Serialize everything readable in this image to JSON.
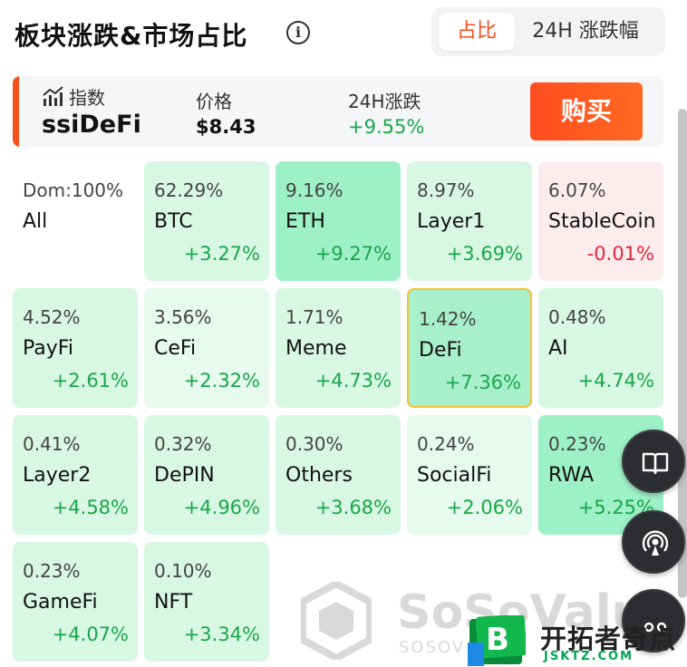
{
  "header": {
    "title": "板块涨跌&市场占比",
    "info_icon": "info-icon",
    "tabs": [
      {
        "label": "占比",
        "active": true
      },
      {
        "label": "24H 涨跌幅",
        "active": false
      }
    ]
  },
  "index_bar": {
    "icon": "chart-icon",
    "label": "指数",
    "name": "ssiDeFi",
    "price_label": "价格",
    "price_value": "$8.43",
    "change_label": "24H涨跌",
    "change_value": "+9.55%",
    "buy_label": "购买"
  },
  "sectors": [
    {
      "pct": "Dom:100%",
      "name": "All",
      "change": "",
      "color": "#ffffff",
      "direction": "none"
    },
    {
      "pct": "62.29%",
      "name": "BTC",
      "change": "+3.27%",
      "color": "#d8f8e4",
      "direction": "up"
    },
    {
      "pct": "9.16%",
      "name": "ETH",
      "change": "+9.27%",
      "color": "#9ef0c6",
      "direction": "up"
    },
    {
      "pct": "8.97%",
      "name": "Layer1",
      "change": "+3.69%",
      "color": "#d8f8e4",
      "direction": "up"
    },
    {
      "pct": "6.07%",
      "name": "StableCoin",
      "change": "-0.01%",
      "color": "#fdecee",
      "direction": "down"
    },
    {
      "pct": "4.52%",
      "name": "PayFi",
      "change": "+2.61%",
      "color": "#d8f8e4",
      "direction": "up"
    },
    {
      "pct": "3.56%",
      "name": "CeFi",
      "change": "+2.32%",
      "color": "#e6faee",
      "direction": "up"
    },
    {
      "pct": "1.71%",
      "name": "Meme",
      "change": "+4.73%",
      "color": "#d8f8e4",
      "direction": "up"
    },
    {
      "pct": "1.42%",
      "name": "DeFi",
      "change": "+7.36%",
      "color": "#a8f0cc",
      "direction": "up",
      "selected": true
    },
    {
      "pct": "0.48%",
      "name": "AI",
      "change": "+4.74%",
      "color": "#d8f8e4",
      "direction": "up"
    },
    {
      "pct": "0.41%",
      "name": "Layer2",
      "change": "+4.58%",
      "color": "#d8f8e4",
      "direction": "up"
    },
    {
      "pct": "0.32%",
      "name": "DePIN",
      "change": "+4.96%",
      "color": "#d8f8e4",
      "direction": "up"
    },
    {
      "pct": "0.30%",
      "name": "Others",
      "change": "+3.68%",
      "color": "#d8f8e4",
      "direction": "up"
    },
    {
      "pct": "0.24%",
      "name": "SocialFi",
      "change": "+2.06%",
      "color": "#e6faee",
      "direction": "up"
    },
    {
      "pct": "0.23%",
      "name": "RWA",
      "change": "+5.25%",
      "color": "#9ef0c6",
      "direction": "up"
    },
    {
      "pct": "0.23%",
      "name": "GameFi",
      "change": "+4.07%",
      "color": "#d8f8e4",
      "direction": "up"
    },
    {
      "pct": "0.10%",
      "name": "NFT",
      "change": "+3.34%",
      "color": "#d8f8e4",
      "direction": "up"
    }
  ],
  "watermark": {
    "text": "SoSoValu",
    "sub": "SOSOV"
  },
  "floating_buttons": [
    {
      "icon": "book-icon"
    },
    {
      "icon": "broadcast-icon"
    },
    {
      "icon": "more-icon"
    }
  ],
  "badge": {
    "icon_letter": "B",
    "text": "开拓者奇点",
    "sub": "JSKTZ.COM"
  },
  "colors": {
    "accent": "#f5501e",
    "up": "#1aa64a",
    "down": "#e0293a"
  }
}
